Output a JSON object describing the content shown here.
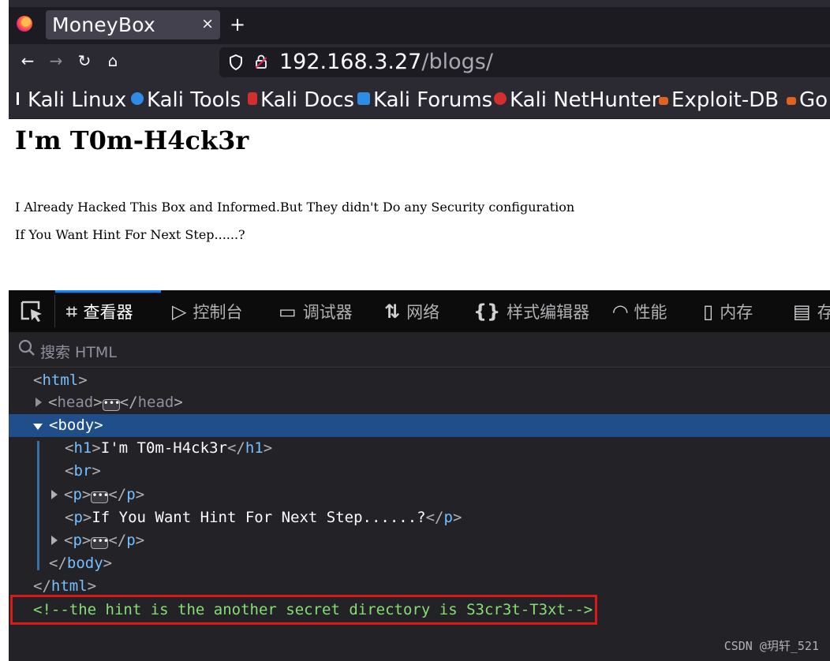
{
  "browser": {
    "tab_title": "MoneyBox",
    "tab_close": "×",
    "new_tab": "+",
    "url_host": "192.168.3.27",
    "url_path": "/blogs/"
  },
  "bookmarks": [
    {
      "label": "Kali Linux",
      "color": "#0f4b8f"
    },
    {
      "label": "Kali Tools",
      "color": "#2f8ce6"
    },
    {
      "label": "Kali Docs",
      "color": "#d32f2f"
    },
    {
      "label": "Kali Forums",
      "color": "#2f8ce6"
    },
    {
      "label": "Kali NetHunter",
      "color": "#d32f2f"
    },
    {
      "label": "Exploit-DB",
      "color": "#e0631f"
    },
    {
      "label": "Go",
      "color": "#e0631f"
    }
  ],
  "page": {
    "heading": "I'm T0m-H4ck3r",
    "paragraph1": "I Already Hacked This Box and Informed.But They didn't Do any Security configuration",
    "paragraph2": "If You Want Hint For Next Step......?"
  },
  "devtools": {
    "tabs": [
      {
        "label": "查看器",
        "icon": "inspector-icon"
      },
      {
        "label": "控制台",
        "icon": "console-icon"
      },
      {
        "label": "调试器",
        "icon": "debugger-icon"
      },
      {
        "label": "网络",
        "icon": "network-icon"
      },
      {
        "label": "样式编辑器",
        "icon": "style-editor-icon"
      },
      {
        "label": "性能",
        "icon": "performance-icon"
      },
      {
        "label": "内存",
        "icon": "memory-icon"
      },
      {
        "label": "存",
        "icon": "storage-icon"
      }
    ],
    "search_placeholder": "搜索 HTML",
    "markup": {
      "h1_text": "I'm T0m-H4ck3r",
      "p_text": "If You Want Hint For Next Step......?",
      "comment": "<!--the hint is the another secret directory is S3cr3t-T3xt-->"
    }
  },
  "watermark": "CSDN @玥轩_521",
  "colors": {
    "accent": "#0a84ff",
    "selection": "#204e8a",
    "highlight_box": "#d91a1a",
    "comment": "#86de74"
  }
}
